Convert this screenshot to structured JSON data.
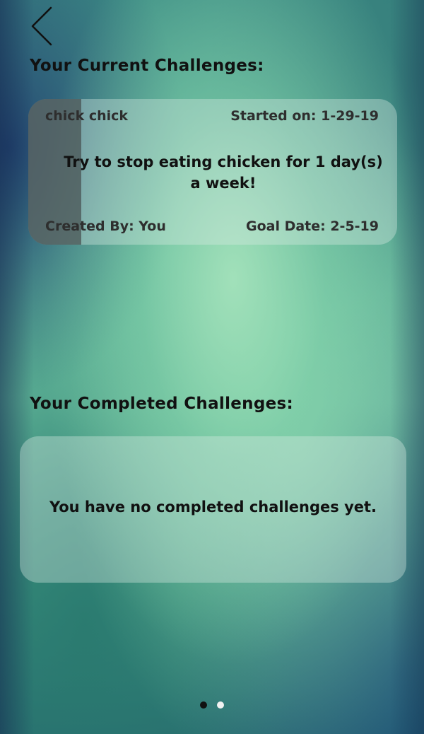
{
  "nav": {
    "back_icon": "chevron-left-icon"
  },
  "current": {
    "title": "Your Current Challenges:",
    "challenge": {
      "name": "chick chick",
      "started": "Started on: 1-29-19",
      "description": "Try to stop eating chicken for 1 day(s) a week!",
      "created_by": "Created By: You",
      "goal_date": "Goal Date: 2-5-19"
    }
  },
  "completed": {
    "title": "Your Completed Challenges:",
    "empty_message": "You have no completed challenges yet."
  },
  "pager": {
    "pages": 2,
    "current_page": 1
  },
  "colors": {
    "card_sidebar": "#464f50",
    "active_dot": "#111111",
    "inactive_dot": "#f2f2f2"
  }
}
